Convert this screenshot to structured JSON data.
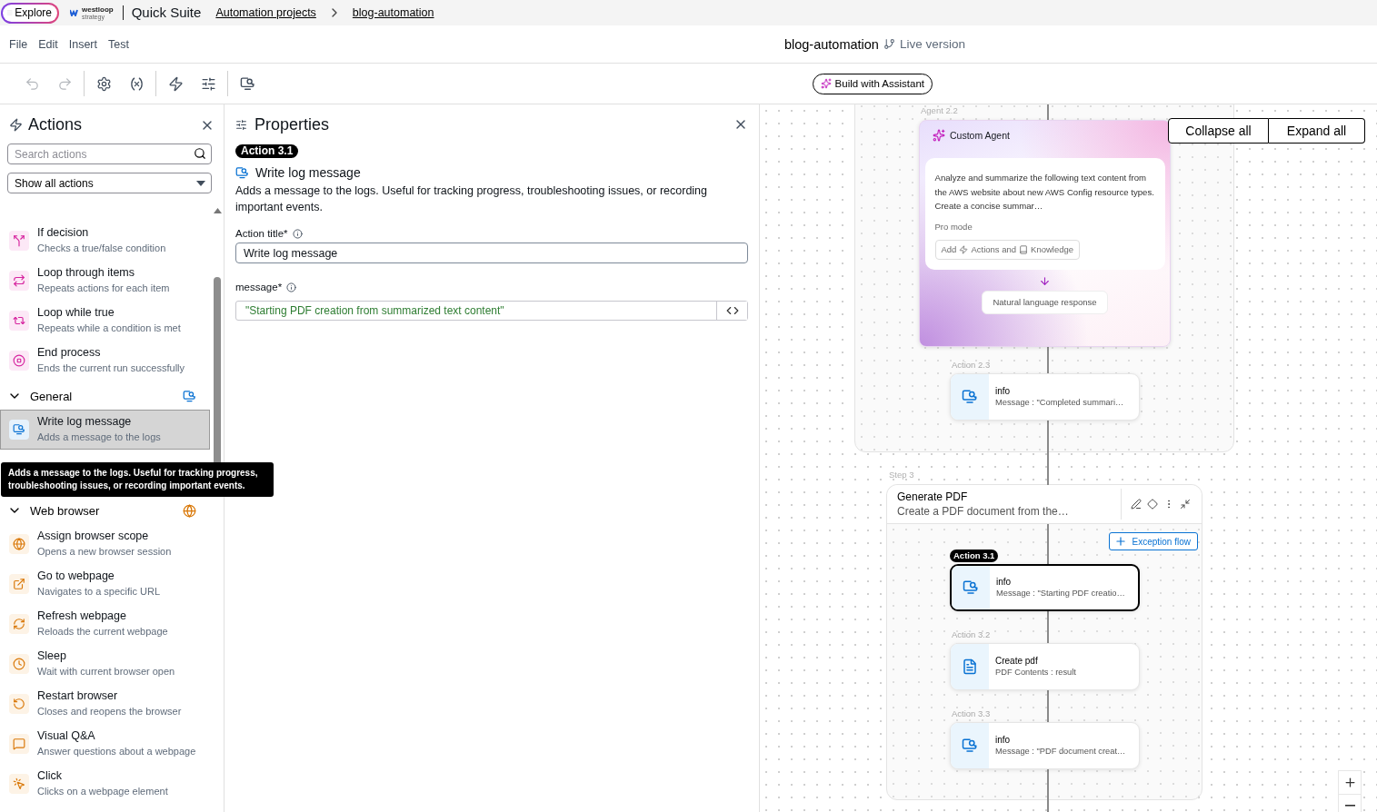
{
  "top_bar": {
    "explore": "Explore",
    "logo": {
      "name": "westloop",
      "tagline": "strategy"
    },
    "app_name": "Quick Suite",
    "breadcrumbs": [
      "Automation projects",
      "blog-automation"
    ]
  },
  "menu": [
    "File",
    "Edit",
    "Insert",
    "Test"
  ],
  "document": {
    "title": "blog-automation",
    "version": "Live version"
  },
  "toolbar": {
    "tool_groups": [
      [
        {
          "kind": "undo",
          "disabled": true
        },
        {
          "kind": "redo",
          "disabled": true
        }
      ],
      [
        {
          "kind": "settings",
          "disabled": false
        },
        {
          "kind": "variable",
          "disabled": false
        }
      ],
      [
        {
          "kind": "actions",
          "disabled": false
        },
        {
          "kind": "properties",
          "disabled": false
        }
      ],
      [
        {
          "kind": "log",
          "disabled": false
        }
      ]
    ],
    "assistant_button": "Build with Assistant"
  },
  "actions_panel": {
    "title": "Actions",
    "search": {
      "placeholder": "Search actions"
    },
    "filter": "Show all actions",
    "groups": [
      {
        "kind": "flow",
        "items": [
          {
            "kind": "split",
            "title": "If decision",
            "description": "Checks a true/false condition",
            "selected": false
          },
          {
            "kind": "repeat",
            "title": "Loop through items",
            "description": "Repeats actions for each item",
            "selected": false
          },
          {
            "kind": "repeat-while",
            "title": "Loop while true",
            "description": "Repeats while a condition is met",
            "selected": false
          },
          {
            "kind": "stop",
            "title": "End process",
            "description": "Ends the current run successfully",
            "selected": false
          }
        ]
      },
      {
        "name": "General",
        "kind": "log",
        "expanded": true,
        "items": [
          {
            "kind": "log",
            "title": "Write log message",
            "description": "Adds a message to the logs",
            "selected": true
          }
        ]
      },
      {
        "name": "Web browser",
        "kind": "globe",
        "expanded": true,
        "items": [
          {
            "kind": "globe",
            "title": "Assign browser scope",
            "description": "Opens a new browser session",
            "selected": false
          },
          {
            "kind": "open-link",
            "title": "Go to webpage",
            "description": "Navigates to a specific URL",
            "selected": false
          },
          {
            "kind": "refresh",
            "title": "Refresh webpage",
            "description": "Reloads the current webpage",
            "selected": false
          },
          {
            "kind": "clock",
            "title": "Sleep",
            "description": "Wait with current browser open",
            "selected": false
          },
          {
            "kind": "restart",
            "title": "Restart browser",
            "description": "Closes and reopens the browser",
            "selected": false
          },
          {
            "kind": "question",
            "title": "Visual Q&A",
            "description": "Answer questions about a webpage",
            "selected": false
          },
          {
            "kind": "click",
            "title": "Click",
            "description": "Clicks on a webpage element",
            "selected": false
          }
        ]
      }
    ]
  },
  "tooltip": "Adds a message to the logs. Useful for tracking progress, troubleshooting issues, or recording important events.",
  "properties_panel": {
    "title": "Properties",
    "badge": "Action 3.1",
    "action_name": "Write log message",
    "description": "Adds a message to the logs. Useful for tracking progress, troubleshooting issues, or recording important events.",
    "fields": [
      {
        "kind": "text",
        "label": "Action title*",
        "value": "Write log message"
      },
      {
        "kind": "expression",
        "label": "message*",
        "value": "\"Starting PDF creation from summarized text content\""
      }
    ]
  },
  "canvas": {
    "collapse_all": "Collapse all",
    "expand_all": "Expand all",
    "agent": {
      "label": "Agent 2.2",
      "title": "Custom Agent",
      "prompt": "Analyze and summarize the following text content from the AWS website about new AWS Config resource types. Create a concise summar…",
      "mode": "Pro mode",
      "add": [
        "Add",
        "Actions and",
        "Knowledge"
      ],
      "output": "Natural language response"
    },
    "step2_actions": [
      {
        "label": "Action 2.3",
        "kind": "log",
        "title": "info",
        "detail": "Message : \"Completed summari…",
        "selected": false
      }
    ],
    "step3": {
      "label": "Step 3",
      "title": "Generate PDF",
      "subtitle": "Create a PDF document from the…",
      "exception_button": "Exception flow",
      "actions": [
        {
          "label": "Action 3.1",
          "kind": "log",
          "title": "info",
          "detail": "Message : \"Starting PDF creatio…",
          "selected": true
        },
        {
          "label": "Action 3.2",
          "kind": "pdf",
          "title": "Create pdf",
          "detail": "PDF Contents : result",
          "selected": false
        },
        {
          "label": "Action 3.3",
          "kind": "log",
          "title": "info",
          "detail": "Message : \"PDF document creat…",
          "selected": false
        }
      ]
    }
  }
}
